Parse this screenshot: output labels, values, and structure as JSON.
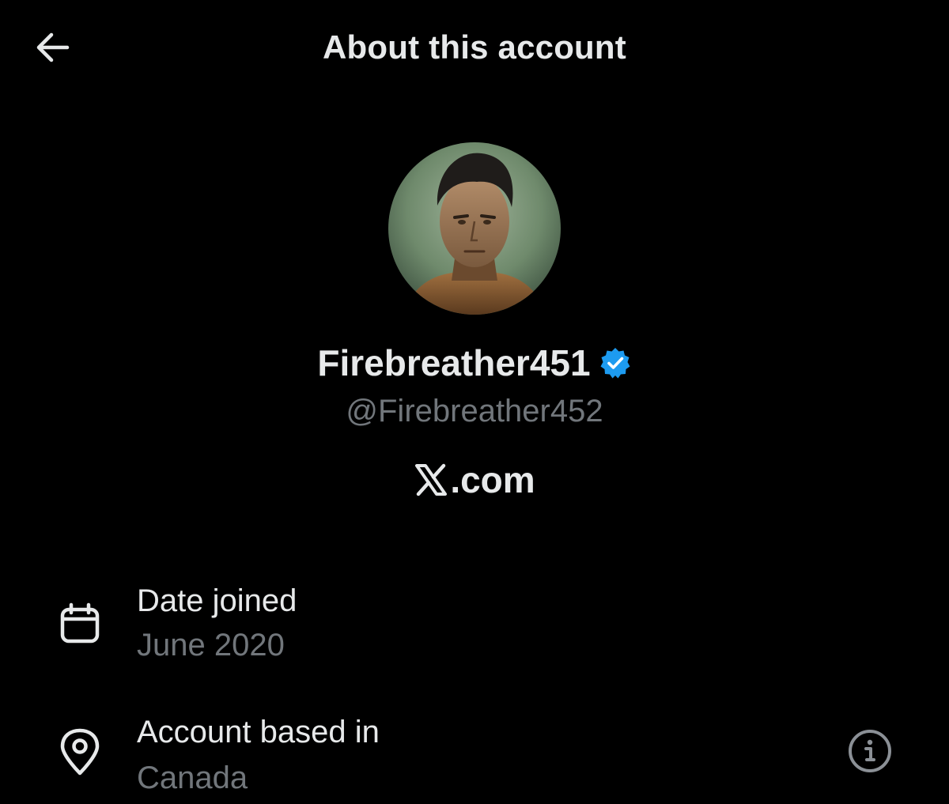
{
  "header": {
    "title": "About this account",
    "back_icon": "arrow-left-icon"
  },
  "profile": {
    "avatar_icon": "profile-avatar",
    "display_name": "Firebreather451",
    "verified_icon": "verified-badge-icon",
    "verified_color": "#1d9bf0",
    "handle": "@Firebreather452",
    "website_prefix_icon": "x-logo-icon",
    "website_text": ".com"
  },
  "details": {
    "date_joined": {
      "icon": "calendar-icon",
      "label": "Date joined",
      "value": "June 2020"
    },
    "account_based_in": {
      "icon": "location-pin-icon",
      "label": "Account based in",
      "value": "Canada",
      "info_icon": "info-icon"
    }
  },
  "colors": {
    "background": "#000000",
    "primary_text": "#e7e9ea",
    "secondary_text": "#71767b",
    "accent": "#1d9bf0"
  }
}
